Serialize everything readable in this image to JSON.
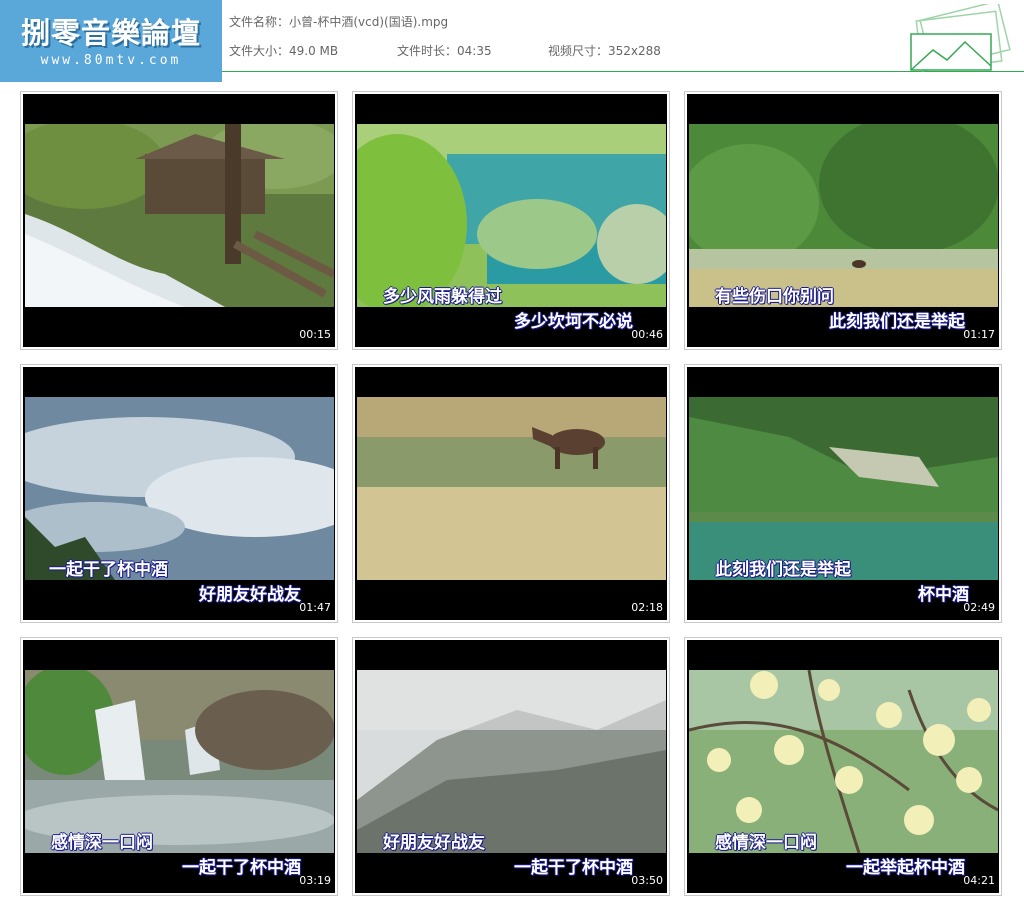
{
  "logo": {
    "title": "捌零音樂論壇",
    "url": "www.80mtv.com"
  },
  "file_info": {
    "name_label": "文件名称：",
    "name": "小曾-杯中酒(vcd)(国语).mpg",
    "size_label": "文件大小：",
    "size": "49.0 MB",
    "duration_label": "文件时长：",
    "duration": "04:35",
    "resolution_label": "视频尺寸：",
    "resolution": "352x288"
  },
  "thumbnails": [
    {
      "time": "00:15",
      "line1": "",
      "line2": "",
      "scene": "waterfall-cabin"
    },
    {
      "time": "00:46",
      "line1": "多少风雨躲得过",
      "line2": "多少坎坷不必说",
      "scene": "turquoise-lake"
    },
    {
      "time": "01:17",
      "line1": "有些伤口你别问",
      "line2": "此刻我们还是举起",
      "scene": "forest-meadow"
    },
    {
      "time": "01:47",
      "line1": "一起干了杯中酒",
      "line2": "好朋友好战友",
      "scene": "cloudy-sky"
    },
    {
      "time": "02:18",
      "line1": "",
      "line2": "",
      "scene": "horse-reeds"
    },
    {
      "time": "02:49",
      "line1": "此刻我们还是举起",
      "line2": "杯中酒",
      "scene": "mountain-lake"
    },
    {
      "time": "03:19",
      "line1": "感情深一口闷",
      "line2": "一起干了杯中酒",
      "scene": "waterfall-rocks"
    },
    {
      "time": "03:50",
      "line1": "好朋友好战友",
      "line2": "一起干了杯中酒",
      "scene": "misty-mountain"
    },
    {
      "time": "04:21",
      "line1": "感情深一口闷",
      "line2": "一起举起杯中酒",
      "scene": "yellow-blossoms"
    }
  ],
  "colors": {
    "accent_line": "#35a853",
    "logo_bg": "#5aa7da",
    "lyric_outline": "#1a1a8c"
  }
}
